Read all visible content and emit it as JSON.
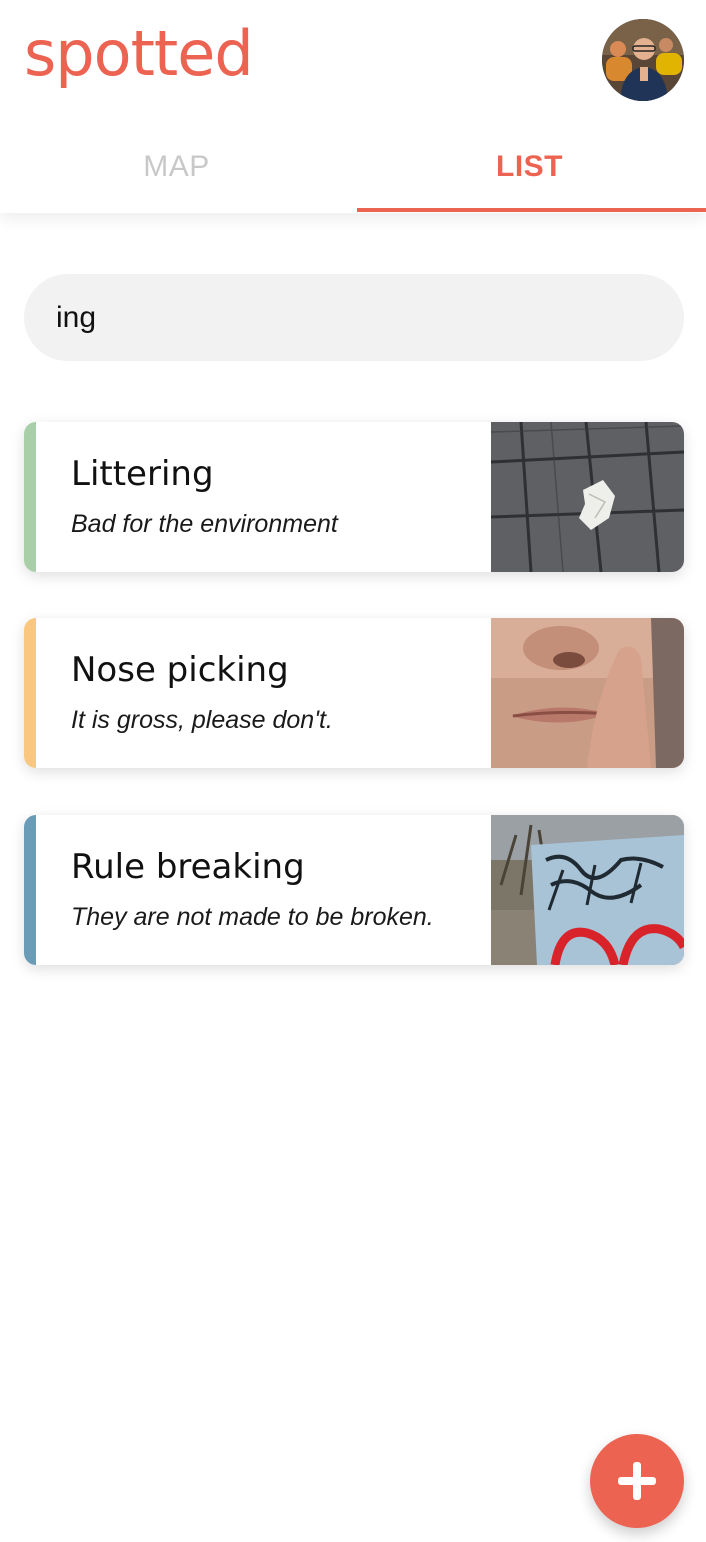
{
  "app": {
    "logo_text": "spotted",
    "brand_color": "#ec6352"
  },
  "header": {
    "avatar_icon": "user-avatar",
    "tabs": [
      {
        "label": "MAP",
        "active": false
      },
      {
        "label": "LIST",
        "active": true
      }
    ]
  },
  "search": {
    "value": "ing",
    "placeholder": ""
  },
  "list": {
    "items": [
      {
        "title": "Littering",
        "subtitle": "Bad for the environment",
        "accent": "#a9cfa8",
        "image": "crumpled-paper-on-pavement"
      },
      {
        "title": "Nose picking",
        "subtitle": "It is gross, please don't.",
        "accent": "#f9c77f",
        "image": "person-picking-nose"
      },
      {
        "title": "Rule breaking",
        "subtitle": "They are not made to be broken.",
        "accent": "#6a9cb8",
        "image": "graffiti-on-utility-box"
      }
    ]
  },
  "fab": {
    "icon": "plus-icon"
  }
}
